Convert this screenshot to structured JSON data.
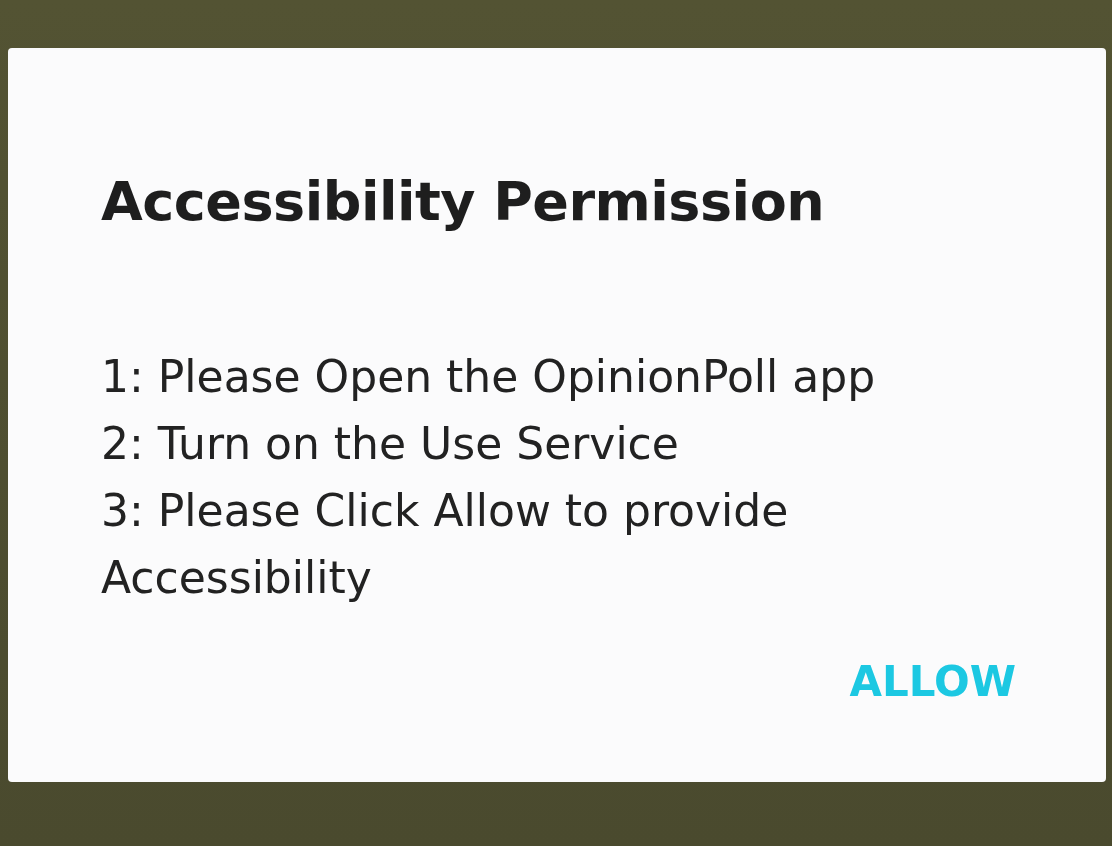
{
  "dialog": {
    "title": "Accessibility Permission",
    "steps": [
      "1: Please Open the OpinionPoll app",
      "2: Turn on the Use Service",
      "3: Please Click Allow to provide Accessibility"
    ],
    "buttons": [
      "ALLOW"
    ]
  }
}
